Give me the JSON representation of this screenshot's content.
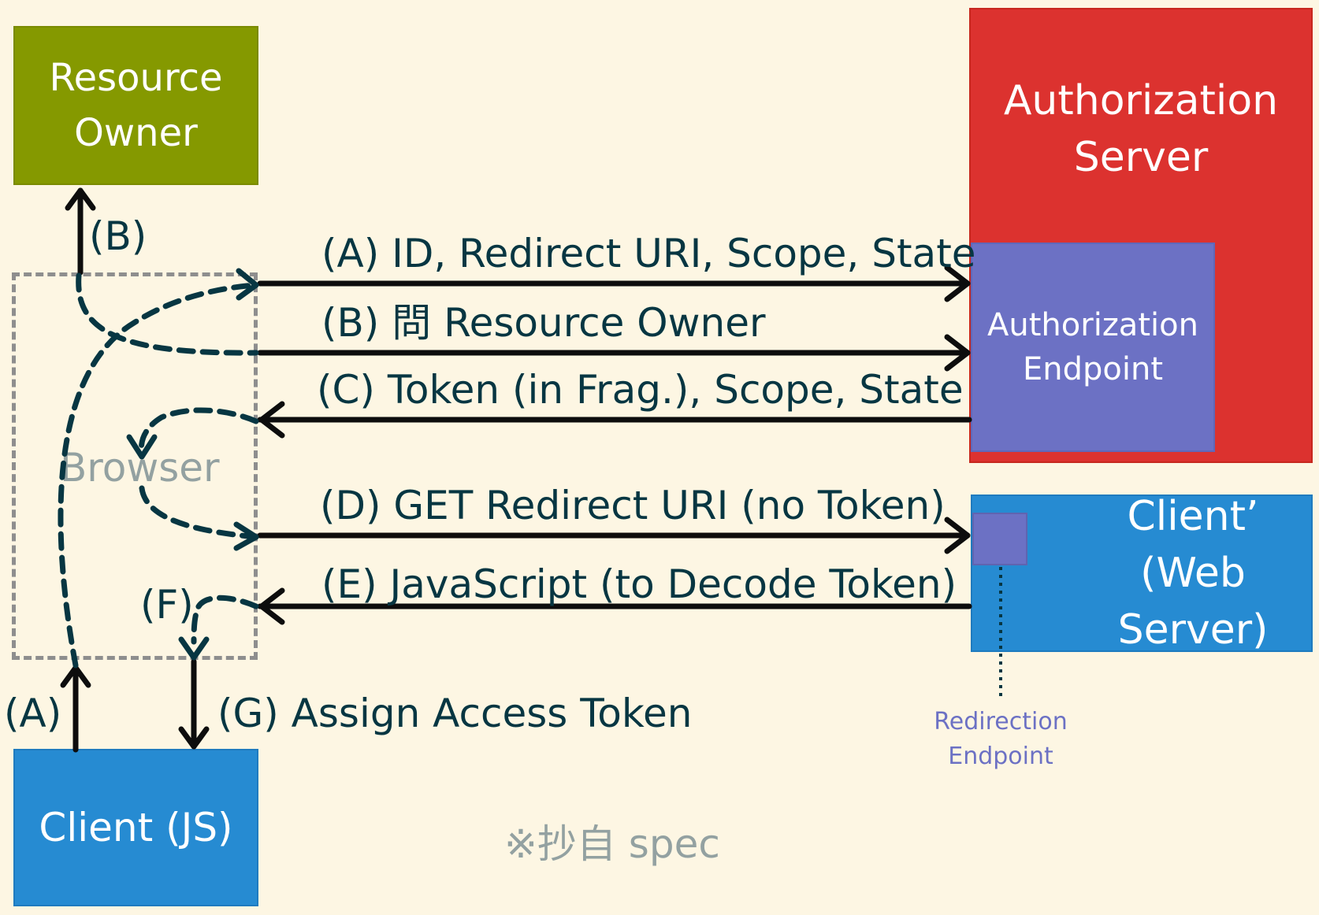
{
  "resource_owner": {
    "line1": "Resource",
    "line2": "Owner"
  },
  "authorization_server": {
    "line1": "Authorization",
    "line2": "Server"
  },
  "authorization_endpoint": {
    "line1": "Authorization",
    "line2": "Endpoint"
  },
  "client_web": {
    "line1": "Client’",
    "line2": "(Web Server)"
  },
  "client_js": {
    "label": "Client (JS)"
  },
  "browser": {
    "label": "Browser"
  },
  "redirection_endpoint": {
    "line1": "Redirection",
    "line2": "Endpoint"
  },
  "flows": {
    "a_label": "(A) ID, Redirect URI, Scope, State",
    "b_label": "(B) 問 Resource Owner",
    "c_label": "(C) Token (in Frag.), Scope, State",
    "d_label": "(D) GET Redirect URI (no Token)",
    "e_label": "(E) JavaScript (to Decode Token)",
    "b_short": "(B)",
    "a_short": "(A)",
    "f_short": "(F)",
    "g_label": "(G) Assign Access Token"
  },
  "note": "※抄自 spec"
}
